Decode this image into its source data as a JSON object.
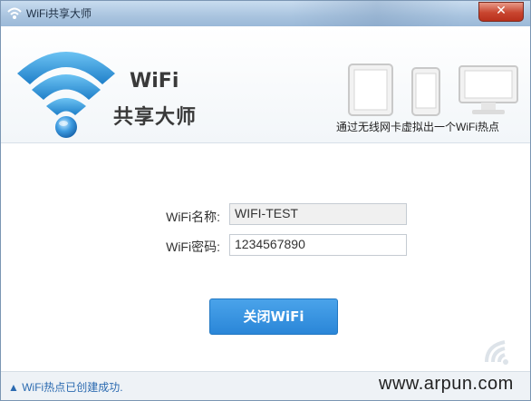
{
  "window": {
    "title": "WiFi共享大师",
    "close_symbol": "✕",
    "icon": "wifi-icon"
  },
  "header": {
    "brand_line1": "WiFi",
    "brand_line2": "共享大师",
    "caption": "通过无线网卡虚拟出一个WiFi热点",
    "devices": [
      "tablet-icon",
      "phone-icon",
      "monitor-icon"
    ]
  },
  "form": {
    "name_label": "WiFi名称:",
    "name_value": "WIFI-TEST",
    "password_label": "WiFi密码:",
    "password_value": "1234567890"
  },
  "actions": {
    "toggle_label": "关闭WiFi"
  },
  "status": {
    "message": "▲ WiFi热点已创建成功."
  },
  "watermark": "www.arpun.com",
  "colors": {
    "accent": "#2a86d8",
    "titlebar": "#a9c4df",
    "status_text": "#2b6ab0",
    "close": "#c8452f"
  }
}
